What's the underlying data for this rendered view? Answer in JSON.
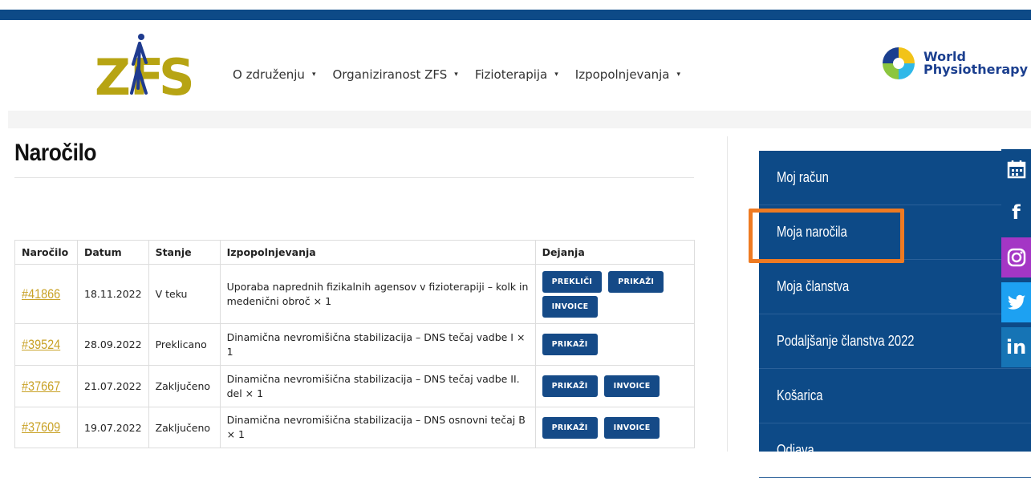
{
  "brand": {
    "logo_text": "ZFS",
    "partner_line1": "World",
    "partner_line2": "Physiotherapy"
  },
  "nav": {
    "items": [
      {
        "label": "O združenju",
        "caret": "▾"
      },
      {
        "label": "Organiziranost ZFS",
        "caret": "▾"
      },
      {
        "label": "Fizioterapija",
        "caret": "▾"
      },
      {
        "label": "Izpopolnjevanja",
        "caret": "▾"
      }
    ]
  },
  "page": {
    "title": "Naročilo"
  },
  "orders": {
    "headers": [
      "Naročilo",
      "Datum",
      "Stanje",
      "Izpopolnjevanja",
      "Dejanja"
    ],
    "rows": [
      {
        "id": "#41866",
        "date": "18.11.2022",
        "status": "V teku",
        "product": "Uporaba naprednih fizikalnih agensov v fizioterapiji – kolk in medenični obroč × 1",
        "actions": [
          "PREKLIČI",
          "PRIKAŽI",
          "INVOICE"
        ]
      },
      {
        "id": "#39524",
        "date": "28.09.2022",
        "status": "Preklicano",
        "product": "Dinamična nevromišična stabilizacija – DNS tečaj vadbe I × 1",
        "actions": [
          "PRIKAŽI"
        ]
      },
      {
        "id": "#37667",
        "date": "21.07.2022",
        "status": "Zaključeno",
        "product": "Dinamična nevromišična stabilizacija – DNS tečaj vadbe II. del × 1",
        "actions": [
          "PRIKAŽI",
          "INVOICE"
        ]
      },
      {
        "id": "#37609",
        "date": "19.07.2022",
        "status": "Zaključeno",
        "product": "Dinamična nevromišična stabilizacija – DNS osnovni tečaj B × 1",
        "actions": [
          "PRIKAŽI",
          "INVOICE"
        ]
      }
    ]
  },
  "sidebar": {
    "items": [
      {
        "label": "Moj račun"
      },
      {
        "label": "Moja naročila"
      },
      {
        "label": "Moja članstva"
      },
      {
        "label": "Podaljšanje članstva 2022"
      },
      {
        "label": "Košarica"
      },
      {
        "label": "Odjava"
      }
    ]
  },
  "social": {
    "icons": [
      "calendar-icon",
      "facebook-icon",
      "instagram-icon",
      "twitter-icon",
      "linkedin-icon"
    ],
    "facebook_glyph": "f",
    "linkedin_glyph": "in"
  },
  "colors": {
    "primary": "#0d4a87",
    "link_gold": "#c9a227",
    "highlight": "#ee7a22",
    "instagram": "#a436c5",
    "twitter": "#1da1f2",
    "linkedin": "#1674b5"
  }
}
